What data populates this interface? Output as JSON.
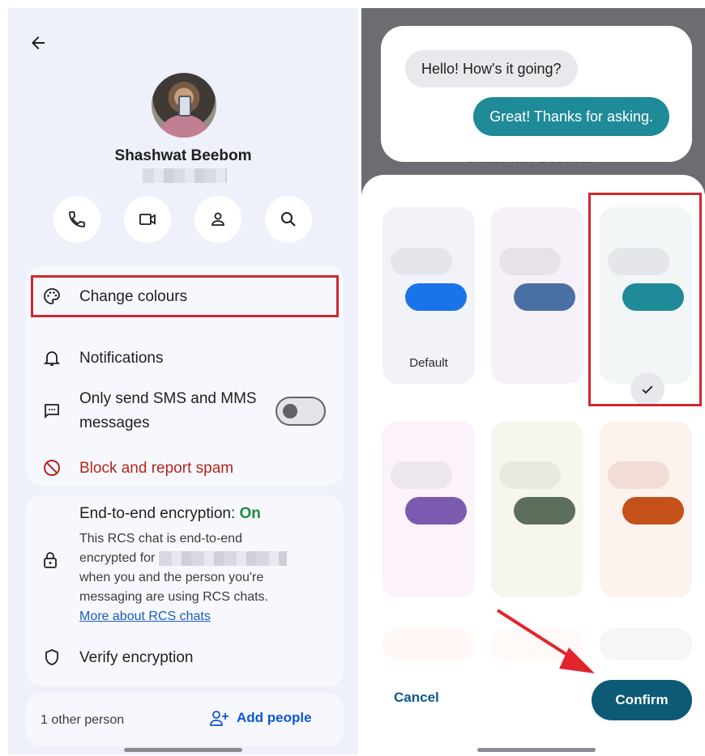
{
  "left": {
    "contact_name": "Shashwat Beebom",
    "actions": [
      {
        "icon": "phone-icon"
      },
      {
        "icon": "video-call-icon"
      },
      {
        "icon": "contact-info-icon"
      },
      {
        "icon": "search-icon"
      }
    ],
    "menu": {
      "change_colours": "Change colours",
      "notifications": "Notifications",
      "sms_only_line1": "Only send SMS and MMS",
      "sms_only_line2": "messages",
      "sms_only_toggle": false,
      "block_spam": "Block and report spam"
    },
    "encryption": {
      "title": "End-to-end encryption: ",
      "status": "On",
      "body_1": "This RCS chat is end-to-end",
      "body_2": "encrypted for",
      "body_3": "when you and the person you're",
      "body_4": "messaging are using RCS chats.",
      "link": "More about RCS chats",
      "verify": "Verify encryption"
    },
    "people": {
      "count_text": "1 other person",
      "add_label": "Add people"
    }
  },
  "right": {
    "preview": {
      "incoming": "Hello! How's it going?",
      "outgoing": "Great! Thanks for asking."
    },
    "swatches": [
      {
        "color": "#1a73e8",
        "label": "Default",
        "selected": false
      },
      {
        "color": "#4a6fa5",
        "label": "",
        "selected": false
      },
      {
        "color": "#1f8a98",
        "label": "",
        "selected": true
      },
      {
        "color": "#7b5bb0",
        "label": "",
        "selected": false
      },
      {
        "color": "#5e6e5c",
        "label": "",
        "selected": false
      },
      {
        "color": "#c4501a",
        "label": "",
        "selected": false
      }
    ],
    "cancel_label": "Cancel",
    "confirm_label": "Confirm"
  },
  "colors": {
    "highlight_red": "#d0272f",
    "encryption_on_green": "#1e8e3e",
    "link_blue": "#1a5fb4",
    "confirm_bg": "#0c5a75",
    "block_red": "#b3261e"
  }
}
